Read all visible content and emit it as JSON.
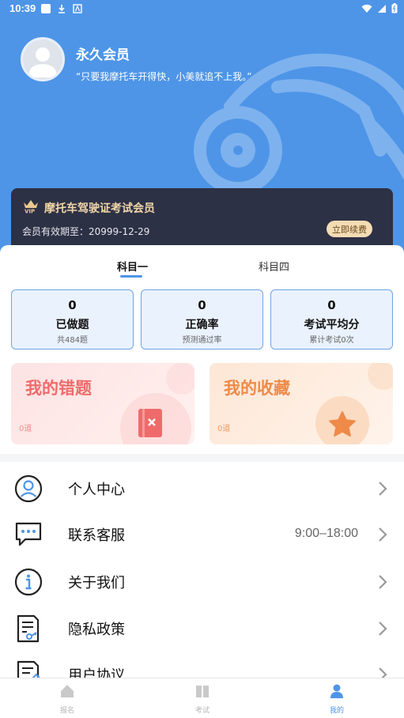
{
  "status_bar": {
    "time": "10:39"
  },
  "profile": {
    "username": "永久会员",
    "slogan": "“只要我摩托车开得快，小美就追不上我。”"
  },
  "vip": {
    "title": "摩托车驾驶证考试会员",
    "expire_text": "会员有效期至：20999-12-29",
    "renew_label": "立即续费"
  },
  "tabs": [
    {
      "label": "科目一",
      "active": true
    },
    {
      "label": "科目四",
      "active": false
    }
  ],
  "stats": [
    {
      "value": "0",
      "label": "已做题",
      "sub": "共484题"
    },
    {
      "value": "0",
      "label": "正确率",
      "sub": "预测通过率"
    },
    {
      "value": "0",
      "label": "考试平均分",
      "sub": "累计考试0次"
    }
  ],
  "features": {
    "wrong": {
      "title": "我的错题",
      "count": "0道"
    },
    "favorites": {
      "title": "我的收藏",
      "count": "0道"
    }
  },
  "menu": [
    {
      "label": "个人中心",
      "extra": "",
      "icon": "user-circle-icon"
    },
    {
      "label": "联系客服",
      "extra": "9:00–18:00",
      "icon": "chat-bubble-icon"
    },
    {
      "label": "关于我们",
      "extra": "",
      "icon": "info-icon"
    },
    {
      "label": "隐私政策",
      "extra": "",
      "icon": "document-key-icon"
    },
    {
      "label": "用户协议",
      "extra": "",
      "icon": "document-edit-icon"
    }
  ],
  "bottom_nav": [
    {
      "label": "报名",
      "icon": "home-icon",
      "active": false
    },
    {
      "label": "考试",
      "icon": "book-icon",
      "active": false
    },
    {
      "label": "我的",
      "icon": "person-icon",
      "active": true
    }
  ],
  "colors": {
    "brand": "#4e95e8",
    "vip_bg": "#2d3145",
    "vip_gold": "#f2d7a8"
  }
}
